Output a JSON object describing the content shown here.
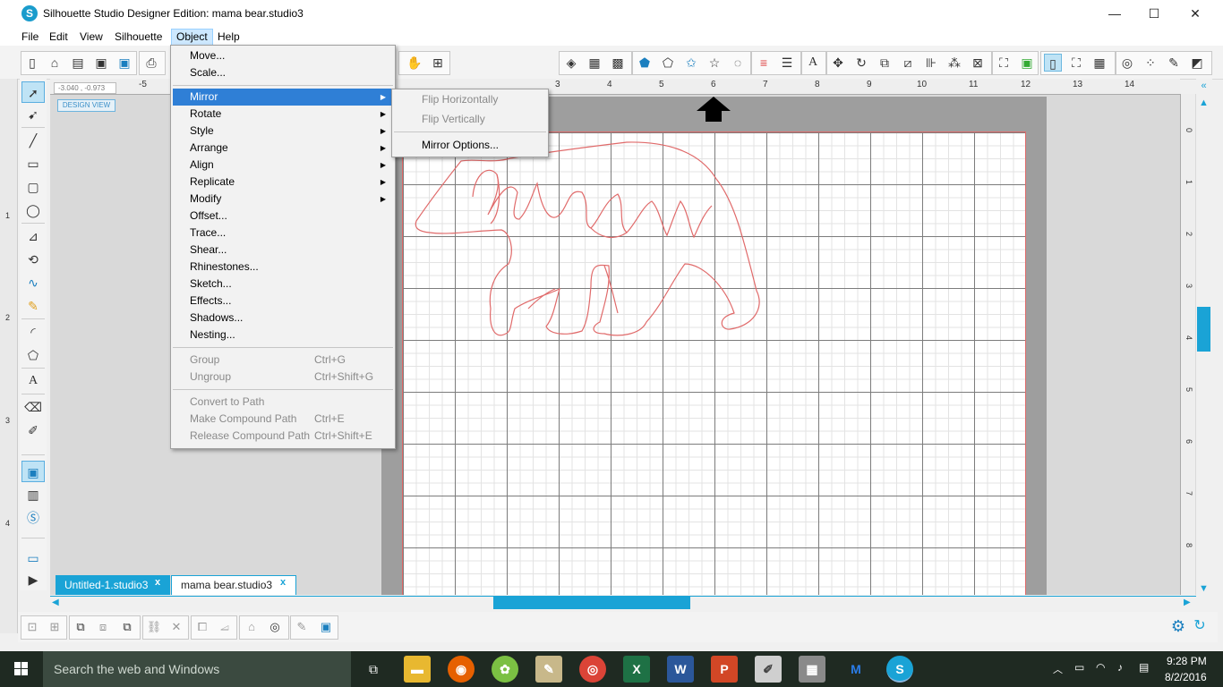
{
  "window": {
    "title": "Silhouette Studio Designer Edition: mama bear.studio3",
    "minimize": "—",
    "maximize": "☐",
    "close": "✕"
  },
  "menubar": [
    "File",
    "Edit",
    "View",
    "Silhouette",
    "Object",
    "Help"
  ],
  "active_menu": "Object",
  "object_menu": {
    "items": [
      {
        "label": "Move...",
        "shortcut": "",
        "submenu": false,
        "enabled": true
      },
      {
        "label": "Scale...",
        "shortcut": "",
        "submenu": false,
        "enabled": true
      },
      {
        "label": "Mirror",
        "shortcut": "",
        "submenu": true,
        "enabled": true,
        "highlighted": true
      },
      {
        "label": "Rotate",
        "shortcut": "",
        "submenu": true,
        "enabled": true
      },
      {
        "label": "Style",
        "shortcut": "",
        "submenu": true,
        "enabled": true
      },
      {
        "label": "Arrange",
        "shortcut": "",
        "submenu": true,
        "enabled": true
      },
      {
        "label": "Align",
        "shortcut": "",
        "submenu": true,
        "enabled": true
      },
      {
        "label": "Replicate",
        "shortcut": "",
        "submenu": true,
        "enabled": true
      },
      {
        "label": "Modify",
        "shortcut": "",
        "submenu": true,
        "enabled": true
      },
      {
        "label": "Offset...",
        "shortcut": "",
        "submenu": false,
        "enabled": true
      },
      {
        "label": "Trace...",
        "shortcut": "",
        "submenu": false,
        "enabled": true
      },
      {
        "label": "Shear...",
        "shortcut": "",
        "submenu": false,
        "enabled": true
      },
      {
        "label": "Rhinestones...",
        "shortcut": "",
        "submenu": false,
        "enabled": true
      },
      {
        "label": "Sketch...",
        "shortcut": "",
        "submenu": false,
        "enabled": true
      },
      {
        "label": "Effects...",
        "shortcut": "",
        "submenu": false,
        "enabled": true
      },
      {
        "label": "Shadows...",
        "shortcut": "",
        "submenu": false,
        "enabled": true
      },
      {
        "label": "Nesting...",
        "shortcut": "",
        "submenu": false,
        "enabled": true
      },
      {
        "label": "Group",
        "shortcut": "Ctrl+G",
        "submenu": false,
        "enabled": false
      },
      {
        "label": "Ungroup",
        "shortcut": "Ctrl+Shift+G",
        "submenu": false,
        "enabled": false
      },
      {
        "label": "Convert to Path",
        "shortcut": "",
        "submenu": false,
        "enabled": false
      },
      {
        "label": "Make Compound Path",
        "shortcut": "Ctrl+E",
        "submenu": false,
        "enabled": false
      },
      {
        "label": "Release Compound Path",
        "shortcut": "Ctrl+Shift+E",
        "submenu": false,
        "enabled": false
      }
    ]
  },
  "mirror_submenu": {
    "items": [
      {
        "label": "Flip Horizontally",
        "enabled": false
      },
      {
        "label": "Flip Vertically",
        "enabled": false
      },
      {
        "label": "Mirror Options...",
        "enabled": true
      }
    ]
  },
  "canvas": {
    "coordinates": "-3.040 , -0.973",
    "view_label": "DESIGN VIEW",
    "ruler_top": [
      "-5",
      "3",
      "4",
      "5",
      "6",
      "7",
      "8",
      "9",
      "10",
      "11",
      "12",
      "13",
      "14"
    ],
    "ruler_right": [
      "0",
      "1",
      "2",
      "3",
      "4",
      "5",
      "6",
      "7",
      "8"
    ],
    "ruler_left": [
      "1",
      "2",
      "3",
      "4",
      "5",
      "6"
    ],
    "design_text": "Mama",
    "cut_line_color": "#e06a6a"
  },
  "tabs": [
    {
      "label": "Untitled-1.studio3",
      "close": "x",
      "active": false
    },
    {
      "label": "mama bear.studio3",
      "close": "x",
      "active": true
    }
  ],
  "taskbar": {
    "search_placeholder": "Search the web and Windows",
    "time": "9:28 PM",
    "date": "8/2/2016",
    "apps": [
      "task-view",
      "file-explorer",
      "firefox",
      "picasa",
      "notepad",
      "chrome",
      "excel",
      "word",
      "powerpoint",
      "paint",
      "calculator",
      "malwarebytes",
      "silhouette-studio"
    ]
  },
  "colors": {
    "accent": "#1aa3d6",
    "menu_highlight": "#2f7fd6",
    "disabled_text": "#8a8a8a"
  }
}
